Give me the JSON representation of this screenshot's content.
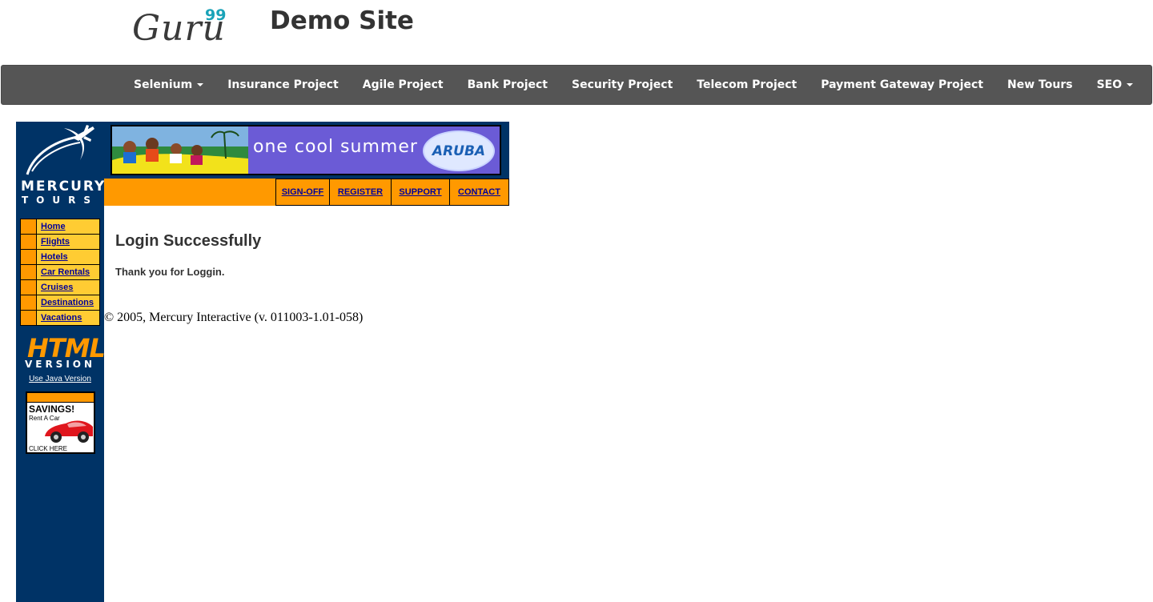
{
  "header": {
    "logo_text": "Guru",
    "logo_sup": "99",
    "site_title": "Demo Site"
  },
  "navbar": {
    "items": [
      {
        "label": "Selenium",
        "dropdown": true
      },
      {
        "label": "Insurance Project",
        "dropdown": false
      },
      {
        "label": "Agile Project",
        "dropdown": false
      },
      {
        "label": "Bank Project",
        "dropdown": false
      },
      {
        "label": "Security Project",
        "dropdown": false
      },
      {
        "label": "Telecom Project",
        "dropdown": false
      },
      {
        "label": "Payment Gateway Project",
        "dropdown": false
      },
      {
        "label": "New Tours",
        "dropdown": false
      },
      {
        "label": "SEO",
        "dropdown": true
      }
    ]
  },
  "sidebar": {
    "logo_line1": "MERCURY",
    "logo_line2": "TOURS",
    "menu": [
      "Home",
      "Flights",
      "Hotels",
      "Car Rentals",
      "Cruises",
      "Destinations",
      "Vacations"
    ],
    "html_word": "HTML",
    "version_word": "VERSION",
    "java_link": "Use Java Version",
    "ad": {
      "title": "SAVINGS!",
      "subtitle": "Rent A Car",
      "cta": "CLICK HERE"
    }
  },
  "banner": {
    "text": "one cool summer",
    "brand": "ARUBA"
  },
  "top_links": [
    "SIGN-OFF",
    "REGISTER",
    "SUPPORT",
    "CONTACT"
  ],
  "main": {
    "heading": "Login Successfully",
    "message": "Thank you for Loggin.",
    "copyright": "© 2005, Mercury Interactive (v. 011003-1.01-058)"
  },
  "colors": {
    "navbar": "#555555",
    "sidebar": "#003366",
    "orange": "#ff9900",
    "menu_yellow": "#ffcc33",
    "link": "#000099"
  }
}
